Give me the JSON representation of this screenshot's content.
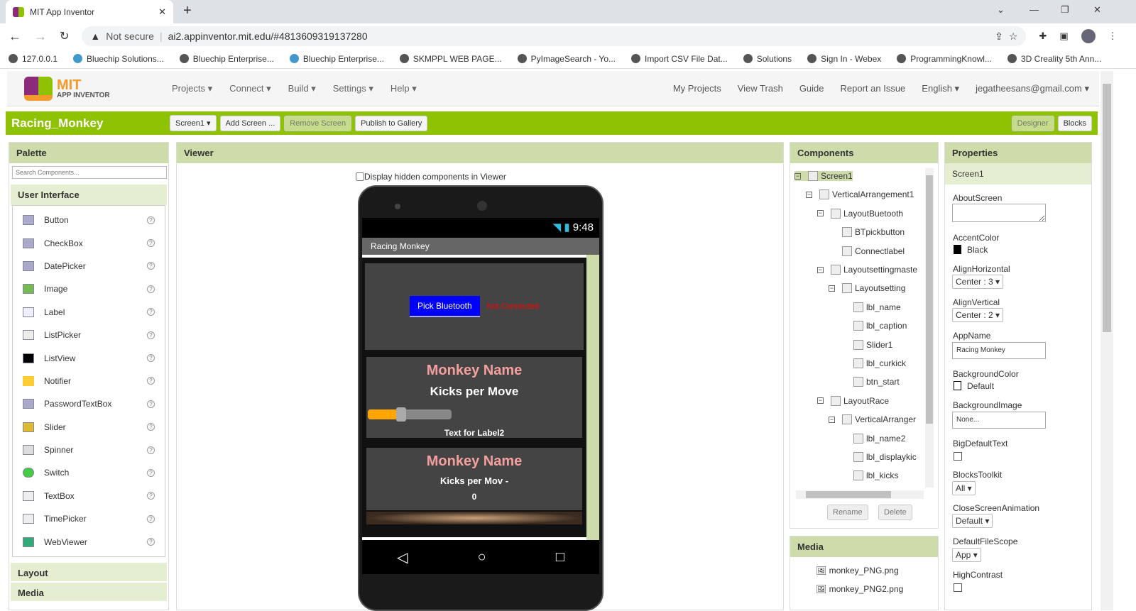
{
  "browser": {
    "tab_title": "MIT App Inventor",
    "security": "Not secure",
    "url": "ai2.appinventor.mit.edu/#4813609319137280",
    "bookmarks": [
      "127.0.0.1",
      "Bluechip Solutions...",
      "Bluechip Enterprise...",
      "Bluechip Enterprise...",
      "SKMPPL WEB PAGE...",
      "PyImageSearch - Yo...",
      "Import CSV File Dat...",
      "Solutions",
      "Sign In - Webex",
      "ProgrammingKnowl...",
      "3D Creality 5th Ann..."
    ]
  },
  "app": {
    "logo_top": "MIT",
    "logo_bottom": "APP INVENTOR",
    "menu": [
      "Projects",
      "Connect",
      "Build",
      "Settings",
      "Help"
    ],
    "right_menu": [
      "My Projects",
      "View Trash",
      "Guide",
      "Report an Issue",
      "English",
      "jegatheesans@gmail.com"
    ]
  },
  "project": {
    "name": "Racing_Monkey",
    "screen_select": "Screen1",
    "add_screen": "Add Screen ...",
    "remove_screen": "Remove Screen",
    "publish": "Publish to Gallery",
    "designer": "Designer",
    "blocks": "Blocks"
  },
  "palette": {
    "title": "Palette",
    "search_placeholder": "Search Components...",
    "section": "User Interface",
    "items": [
      "Button",
      "CheckBox",
      "DatePicker",
      "Image",
      "Label",
      "ListPicker",
      "ListView",
      "Notifier",
      "PasswordTextBox",
      "Slider",
      "Spinner",
      "Switch",
      "TextBox",
      "TimePicker",
      "WebViewer"
    ],
    "sections_after": [
      "Layout",
      "Media"
    ]
  },
  "viewer": {
    "title": "Viewer",
    "hidden_checkbox": "Display hidden components in Viewer",
    "phone": {
      "time": "9:48",
      "app_title": "Racing Monkey",
      "pick_bluetooth": "Pick Bluetooth",
      "not_connected": "Not Connected",
      "monkey_name1": "Monkey Name",
      "kicks_per_move": "Kicks per Move",
      "slider_value": 0.4,
      "label2": "Text for Label2",
      "monkey_name2": "Monkey Name",
      "kicks_per_mov": "Kicks per Mov -",
      "kicks_value": "0"
    }
  },
  "components": {
    "title": "Components",
    "tree": [
      {
        "name": "Screen1",
        "level": 0
      },
      {
        "name": "VerticalArrangement1",
        "level": 1
      },
      {
        "name": "LayoutBuetooth",
        "level": 2
      },
      {
        "name": "BTpickbutton",
        "level": 3
      },
      {
        "name": "Connectlabel",
        "level": 3
      },
      {
        "name": "Layoutsettingmaste",
        "level": 2
      },
      {
        "name": "Layoutsetting",
        "level": 3
      },
      {
        "name": "lbl_name",
        "level": 4
      },
      {
        "name": "lbl_caption",
        "level": 4
      },
      {
        "name": "Slider1",
        "level": 4
      },
      {
        "name": "lbl_curkick",
        "level": 4
      },
      {
        "name": "btn_start",
        "level": 4
      },
      {
        "name": "LayoutRace",
        "level": 2
      },
      {
        "name": "VerticalArranger",
        "level": 3
      },
      {
        "name": "lbl_name2",
        "level": 4
      },
      {
        "name": "lbl_displaykic",
        "level": 4
      },
      {
        "name": "lbl_kicks",
        "level": 4
      }
    ],
    "rename": "Rename",
    "delete": "Delete"
  },
  "media": {
    "title": "Media",
    "files": [
      "monkey_PNG.png",
      "monkey_PNG2.png"
    ]
  },
  "properties": {
    "title": "Properties",
    "component": "Screen1",
    "about_label": "AboutScreen",
    "accent_label": "AccentColor",
    "accent_value": "Black",
    "align_h_label": "AlignHorizontal",
    "align_h_value": "Center : 3",
    "align_v_label": "AlignVertical",
    "align_v_value": "Center : 2",
    "appname_label": "AppName",
    "appname_value": "Racing Monkey",
    "bg_color_label": "BackgroundColor",
    "bg_color_value": "Default",
    "bg_image_label": "BackgroundImage",
    "bg_image_value": "None...",
    "bigtext_label": "BigDefaultText",
    "toolkit_label": "BlocksToolkit",
    "toolkit_value": "All",
    "close_anim_label": "CloseScreenAnimation",
    "close_anim_value": "Default",
    "filescope_label": "DefaultFileScope",
    "filescope_value": "App",
    "contrast_label": "HighContrast"
  },
  "colors": {
    "green": "#8fc202",
    "panel_header": "#cddcaa",
    "bt_button": "#0000ff",
    "not_connected": "#ff0000",
    "monkey_name": "#f4a0a0",
    "slider": "#ffa500"
  }
}
